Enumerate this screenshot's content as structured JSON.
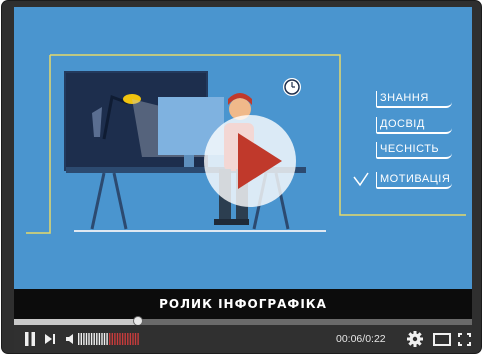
{
  "video": {
    "words": [
      "ЗНАННЯ",
      "ДОСВІД",
      "ЧЕСНІСТЬ",
      "МОТИВАЦІЯ"
    ],
    "caption": "РОЛИК  ІНФОГРАФІКА"
  },
  "player": {
    "progress": 0.27,
    "volume": 0.5,
    "current_time": "00:06",
    "separator": "/",
    "duration": "0:22"
  },
  "icons": {
    "play_overlay": "play-icon",
    "pause": "pause-icon",
    "next": "next-icon",
    "volume": "volume-icon",
    "settings": "gear-icon",
    "theater": "theater-mode-icon",
    "fullscreen": "fullscreen-icon"
  },
  "colors": {
    "video_bg": "#4a95cf",
    "accent_yellow": "#e5d96a",
    "play_triangle": "#c0392b",
    "volume_bar": "#c83c3c"
  }
}
